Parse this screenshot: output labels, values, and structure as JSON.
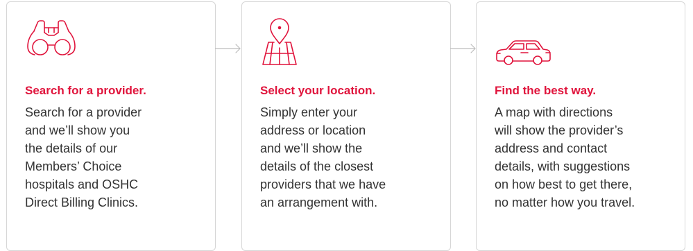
{
  "colors": {
    "accent": "#e0143c",
    "text": "#333333",
    "border": "#d6d6d6",
    "connector": "#bcbcbc"
  },
  "steps": [
    {
      "icon": "binoculars-icon",
      "title": "Search for a provider.",
      "text": "Search for a provider\nand we’ll show you\nthe details of our\nMembers’ Choice\nhospitals and OSHC\nDirect Billing Clinics."
    },
    {
      "icon": "map-location-pin-icon",
      "title": "Select your location.",
      "text": "Simply enter your\naddress or location\nand we’ll show the\ndetails of the closest\nproviders that we have\nan arrangement with."
    },
    {
      "icon": "car-icon",
      "title": "Find the best way.",
      "text": "A map with directions\nwill show the provider’s\naddress and contact\ndetails, with suggestions\non how best to get there,\nno matter how you travel."
    }
  ]
}
